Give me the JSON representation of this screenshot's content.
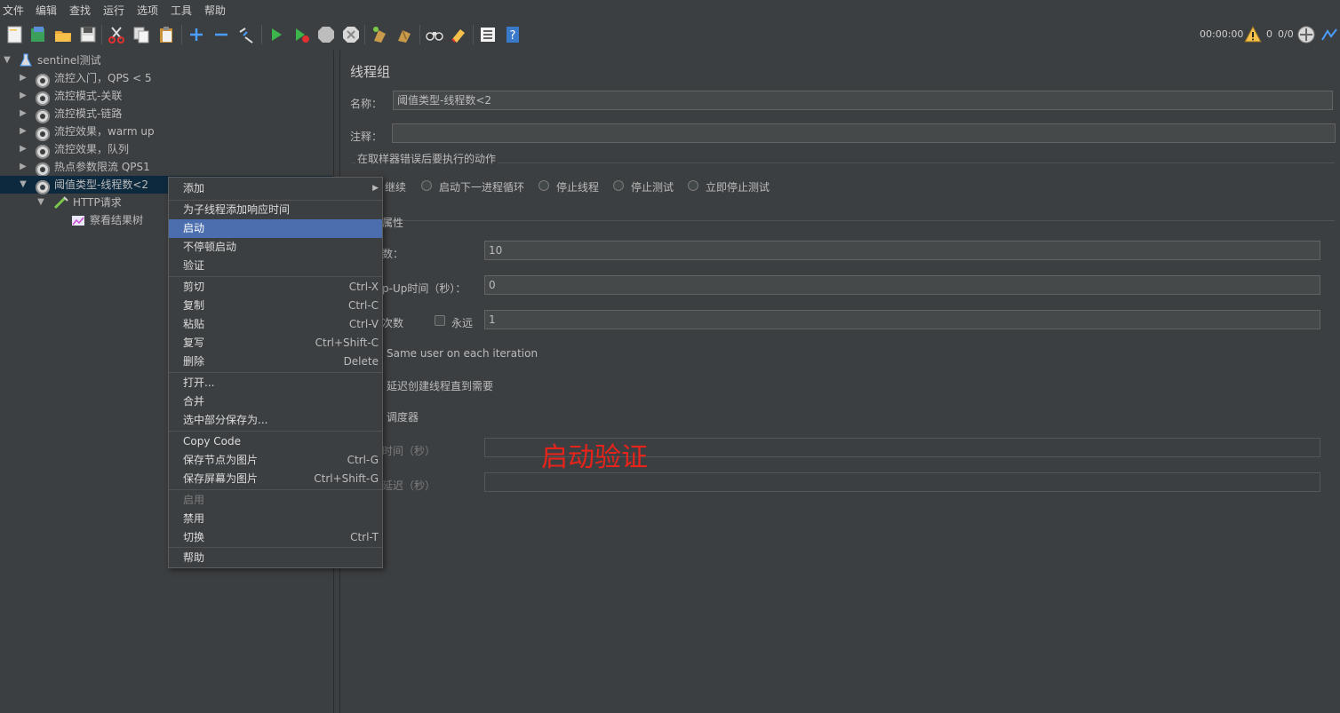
{
  "menubar": [
    "文件",
    "编辑",
    "查找",
    "运行",
    "选项",
    "工具",
    "帮助"
  ],
  "status": {
    "elapsed": "00:00:00",
    "warnings": "0",
    "threads": "0/0"
  },
  "tree": {
    "root": "sentinel测试",
    "items": [
      "流控入门，QPS < 5",
      "流控模式-关联",
      "流控模式-链路",
      "流控效果，warm up",
      "流控效果，队列",
      "热点参数限流 QPS1",
      "阈值类型-线程数<2"
    ],
    "http": "HTTP请求",
    "result": "察看结果树"
  },
  "panel": {
    "title": "线程组",
    "name_label": "名称：",
    "name_value": "阈值类型-线程数<2",
    "comment_label": "注释：",
    "comment_value": "",
    "error_action_title": "在取样器错误后要执行的动作",
    "radio_continue": "继续",
    "radio_next_loop": "启动下一进程循环",
    "radio_stop_thread": "停止线程",
    "radio_stop_test": "停止测试",
    "radio_stop_now": "立即停止测试",
    "props_title": "属性",
    "threads_label": "数：",
    "threads_value": "10",
    "rampup_label": "p-Up时间（秒）：",
    "rampup_value": "0",
    "loop_label": "次数",
    "forever_label": "永远",
    "loop_value": "1",
    "same_user": "Same user on each iteration",
    "delay_create": "延迟创建线程直到需要",
    "scheduler": "调度器",
    "duration_label": "时间（秒）",
    "duration_value": "",
    "startup_delay_label": "延迟（秒）",
    "startup_delay_value": ""
  },
  "context_menu": {
    "add": "添加",
    "add_resp_time": "为子线程添加响应时间",
    "start": "启动",
    "start_no_pause": "不停顿启动",
    "validate": "验证",
    "cut": "剪切",
    "cut_key": "Ctrl-X",
    "copy": "复制",
    "copy_key": "Ctrl-C",
    "paste": "粘贴",
    "paste_key": "Ctrl-V",
    "duplicate": "复写",
    "duplicate_key": "Ctrl+Shift-C",
    "delete": "删除",
    "delete_key": "Delete",
    "open": "打开...",
    "merge": "合并",
    "save_selection": "选中部分保存为...",
    "copy_code": "Copy Code",
    "save_node_img": "保存节点为图片",
    "save_node_img_key": "Ctrl-G",
    "save_screen_img": "保存屏幕为图片",
    "save_screen_img_key": "Ctrl+Shift-G",
    "enable": "启用",
    "disable": "禁用",
    "toggle": "切换",
    "toggle_key": "Ctrl-T",
    "help": "帮助"
  },
  "annotation": "启动验证"
}
